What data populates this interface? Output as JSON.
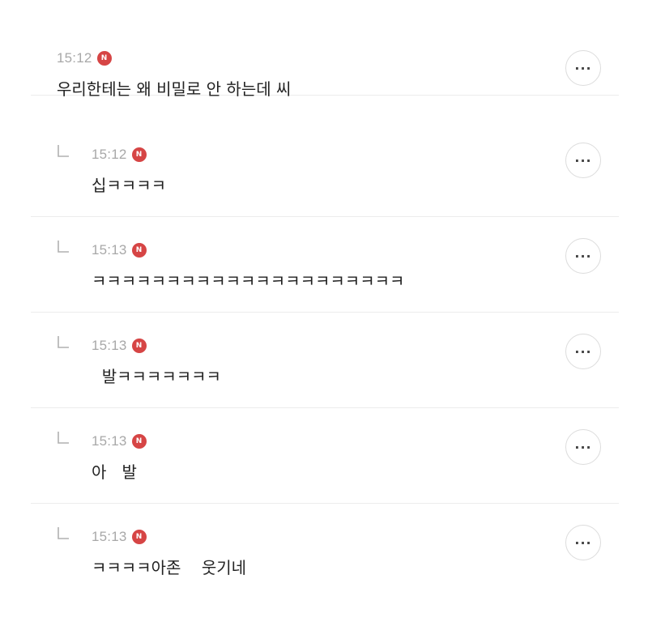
{
  "comments": [
    {
      "time": "15:12",
      "badge": "N",
      "text": "우리한테는 왜 비밀로 안 하는데 씨",
      "is_reply": false,
      "more": "···"
    },
    {
      "time": "15:12",
      "badge": "N",
      "text": "십ㅋㅋㅋㅋ",
      "is_reply": true,
      "more": "···"
    },
    {
      "time": "15:13",
      "badge": "N",
      "text": "ㅋㅋㅋㅋㅋㅋㅋㅋㅋㅋㅋㅋㅋㅋㅋㅋㅋㅋㅋㅋㅋ",
      "is_reply": true,
      "more": "···"
    },
    {
      "time": "15:13",
      "badge": "N",
      "text": "  발ㅋㅋㅋㅋㅋㅋㅋ",
      "is_reply": true,
      "more": "···"
    },
    {
      "time": "15:13",
      "badge": "N",
      "text": "아   발",
      "is_reply": true,
      "more": "···"
    },
    {
      "time": "15:13",
      "badge": "N",
      "text": "ㅋㅋㅋㅋ아존    웃기네",
      "is_reply": true,
      "more": "···"
    }
  ]
}
